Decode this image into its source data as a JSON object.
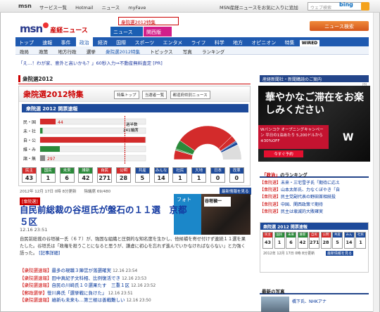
{
  "topbar": {
    "brand": "msn",
    "links": [
      "サービス一覧",
      "Hotmail",
      "ニュース",
      "myFave"
    ],
    "right_text": "MSN産経ニュースをお気に入りに追加",
    "search_placeholder": "ウェブ検索",
    "search_engine": "bing"
  },
  "header": {
    "logo_msn": "msn",
    "logo_sankei": "産経ニュース",
    "election_tab": "衆院選2012特集",
    "tabs": [
      "ニュース",
      "関西版",
      "フォト"
    ],
    "news_search_button": "ニュース検索"
  },
  "nav_main": [
    "トップ",
    "速報",
    "事件",
    "政治",
    "経済",
    "国際",
    "スポーツ",
    "エンタメ",
    "ライフ",
    "科学",
    "地方",
    "オピニオン",
    "特集"
  ],
  "nav_main_active": "政治",
  "nav_main_badge": "WIRED",
  "nav_sub": [
    "政局",
    "政策",
    "地方行政",
    "選挙",
    "衆院選2012特集",
    "トピックス",
    "写真",
    "ランキング"
  ],
  "promo": {
    "text": "「え…！わが家、意外と高いかも？」60秒入力⇒不動産無料査定 [PR]"
  },
  "section": {
    "title": "衆院選2012"
  },
  "banner": {
    "title": "衆院選2012特集",
    "buttons": [
      "特集トップ",
      "当選者一覧",
      "都道府県別ニュース"
    ],
    "subtitle": "衆院選 2012 開票速報",
    "majority_label": "過半数",
    "majority_value": "241議席",
    "bar_labels": [
      "民・国",
      "未・社",
      "自・公",
      "維・み",
      "諸・無"
    ],
    "bar_values": [
      "44",
      "",
      "",
      "",
      "297"
    ],
    "footer": "2012年 12月 17日 0時 8分更新　　除議席 69/480",
    "latest_link": "最新情報を見る"
  },
  "chart_data": {
    "type": "bar",
    "categories": [
      "民主",
      "国民",
      "未来",
      "維新",
      "自民",
      "公明",
      "共産",
      "みんな",
      "社民",
      "大地",
      "日本",
      "改革"
    ],
    "values": [
      43,
      1,
      6,
      42,
      271,
      28,
      5,
      14,
      1,
      1,
      0,
      0
    ],
    "title": "衆院選 2012 開票速報",
    "colors": [
      "#d32b2b",
      "#2b8a3a",
      "#2b8a3a",
      "#2b8a3a",
      "#d32b2b",
      "#d32b2b",
      "#1d4a9a",
      "#1d4a9a",
      "#1d4a9a",
      "#1d4a9a",
      "#1d4a9a",
      "#1d4a9a"
    ]
  },
  "article": {
    "tag": "[衆院選]",
    "headline": "自民前総裁の谷垣氏が盤石の１１選　京都５区",
    "time": "12.16 23:51",
    "body": "自民前総裁の谷垣禎一氏（６７）が、強固な組織と圧倒的な知名度を生かし、他候補を寄せ付けず連続１１選を果たした。谷垣氏は「政権を担うことになると思うが、謙虚に初心を忘れず進んでいかなければならない」と力強く語った。",
    "body_link": "[記事詳細]",
    "photo_sign": "谷垣禎一",
    "related": [
      {
        "src": "【衆院選速報】",
        "text": "最多の現職３陣営が落選確実",
        "time": "12.16 23:54"
      },
      {
        "src": "【衆院選速報】",
        "text": "田中真紀子文科相、比例復活でき",
        "time": "12.16 23:53"
      },
      {
        "src": "【衆院選速報】",
        "text": "自民の川崎氏１０選果たす　三重１区",
        "time": "12.16 23:52"
      },
      {
        "src": "【郵政選挙】",
        "text": "笹川鼻氏「選挙戦に負けた」",
        "time": "12.16 23:51"
      },
      {
        "src": "【衆院選速報】",
        "text": "維新も未来も…第三極は善戦難しい",
        "time": "12.16 23:50"
      }
    ]
  },
  "right": {
    "header": "産経新聞社・新聞購読のご案内",
    "pr": "PR",
    "ad_text": "華やかなご滞在をお楽しみください",
    "ad_strip": "Wバンコク オープニングキャンペーン 平日の1泊あたり 5,200ドルから ※30%OFF",
    "ad_brand": "W",
    "ad_button": "今すぐ予約",
    "ranking_title_a": "「政治」",
    "ranking_title_b": "のランキング",
    "ranking": [
      {
        "src": "【衆院選】",
        "text": "未来・三宅雪子氏「期待に応え"
      },
      {
        "src": "【衆院選】",
        "text": "山本太郎氏、力なくぼやき「自"
      },
      {
        "src": "【衆院選】",
        "text": "民主党副代表の野田首相続投"
      },
      {
        "src": "【衆院選】",
        "text": "中国、関西政策で期待"
      },
      {
        "src": "【衆院選】",
        "text": "民主は壊滅的大敗確実"
      }
    ],
    "mini_title": "衆院選 2012 開票速報",
    "mini_footer": "2012年 12月 17日 0時 8分更新",
    "mini_link": "最新情報を見る",
    "photos_title": "最新の写真",
    "photo_caption": "橋下氏、NHKアナ"
  }
}
